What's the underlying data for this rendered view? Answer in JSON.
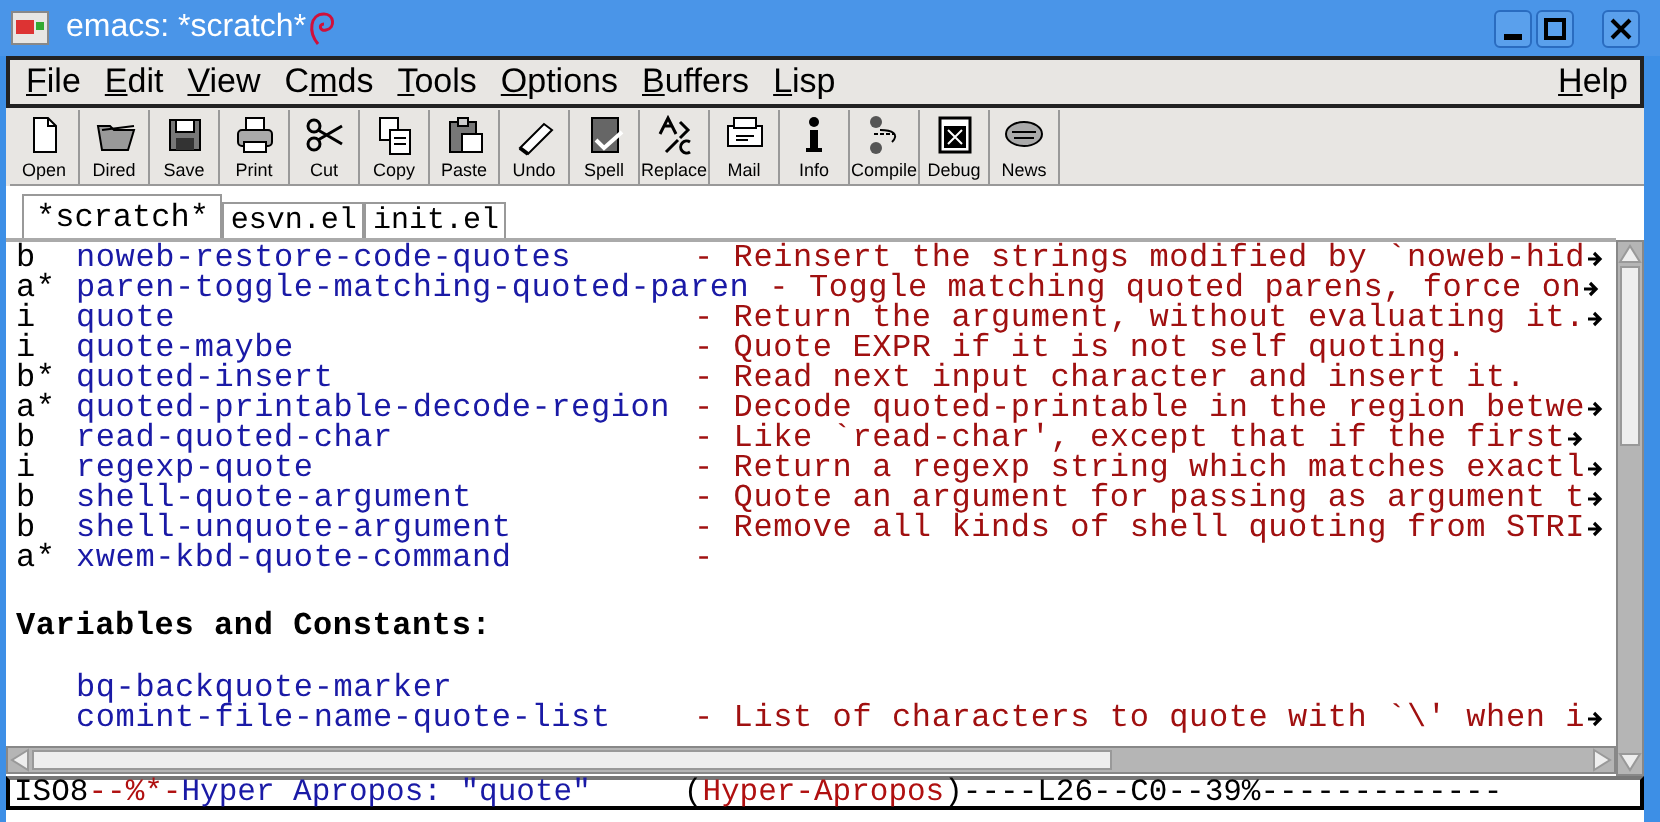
{
  "window": {
    "title": "emacs: *scratch*"
  },
  "menubar": {
    "items": [
      {
        "key": "F",
        "post": "ile"
      },
      {
        "key": "E",
        "post": "dit"
      },
      {
        "key": "V",
        "post": "iew"
      },
      {
        "pre": "C",
        "key": "m",
        "post": "ds"
      },
      {
        "key": "T",
        "post": "ools"
      },
      {
        "key": "O",
        "post": "ptions"
      },
      {
        "key": "B",
        "post": "uffers"
      },
      {
        "key": "L",
        "post": "isp"
      }
    ],
    "help": {
      "key": "H",
      "post": "elp"
    }
  },
  "toolbar": [
    "Open",
    "Dired",
    "Save",
    "Print",
    "Cut",
    "Copy",
    "Paste",
    "Undo",
    "Spell",
    "Replace",
    "Mail",
    "Info",
    "Compile",
    "Debug",
    "News"
  ],
  "tabs": [
    {
      "label": "*scratch*",
      "selected": true
    },
    {
      "label": "esvn.el",
      "selected": false
    },
    {
      "label": "init.el",
      "selected": false
    }
  ],
  "buffer": {
    "lines": [
      {
        "kind": "entry",
        "flag": "b",
        "name": "noweb-restore-code-quotes",
        "desc": "- Reinsert the strings modified by `noweb-hid",
        "truncated": true
      },
      {
        "kind": "entry",
        "flag": "a*",
        "name": "paren-toggle-matching-quoted-paren",
        "desc": "- Toggle matching quoted parens, force on",
        "truncated": true
      },
      {
        "kind": "entry",
        "flag": "i",
        "name": "quote",
        "desc": "- Return the argument, without evaluating it.",
        "truncated": true
      },
      {
        "kind": "entry",
        "flag": "i",
        "name": "quote-maybe",
        "desc": "- Quote EXPR if it is not self quoting.",
        "truncated": false
      },
      {
        "kind": "entry",
        "flag": "b*",
        "name": "quoted-insert",
        "desc": "- Read next input character and insert it.",
        "truncated": false
      },
      {
        "kind": "entry",
        "flag": "a*",
        "name": "quoted-printable-decode-region",
        "desc": "- Decode quoted-printable in the region betwe",
        "truncated": true
      },
      {
        "kind": "entry",
        "flag": "b",
        "name": "read-quoted-char",
        "desc": "- Like `read-char', except that if the first",
        "truncated": true
      },
      {
        "kind": "entry",
        "flag": "i",
        "name": "regexp-quote",
        "desc": "- Return a regexp string which matches exactl",
        "truncated": true
      },
      {
        "kind": "entry",
        "flag": "b",
        "name": "shell-quote-argument",
        "desc": "- Quote an argument for passing as argument t",
        "truncated": true
      },
      {
        "kind": "entry",
        "flag": "b",
        "name": "shell-unquote-argument",
        "desc": "- Remove all kinds of shell quoting from STRI",
        "truncated": true
      },
      {
        "kind": "entry",
        "flag": "a*",
        "name": "xwem-kbd-quote-command",
        "desc": "-",
        "truncated": false
      },
      {
        "kind": "blank"
      },
      {
        "kind": "heading",
        "text": "Variables and Constants:"
      },
      {
        "kind": "blank"
      },
      {
        "kind": "entry",
        "name": "bq-backquote-marker",
        "truncated": false
      },
      {
        "kind": "entry",
        "name": "comint-file-name-quote-list",
        "desc": "- List of characters to quote with `\\' when i",
        "truncated": true
      }
    ]
  },
  "mode_line": [
    {
      "kind": "plain",
      "text": "ISO8"
    },
    {
      "kind": "flag",
      "text": "--%*-"
    },
    {
      "kind": "buffer",
      "text": "Hyper Apropos: \"quote\""
    },
    {
      "kind": "plain",
      "text": "     ("
    },
    {
      "kind": "flag",
      "text": "Hyper-Apropos"
    },
    {
      "kind": "plain",
      "text": ")----L26--C0--39%-------------"
    }
  ]
}
